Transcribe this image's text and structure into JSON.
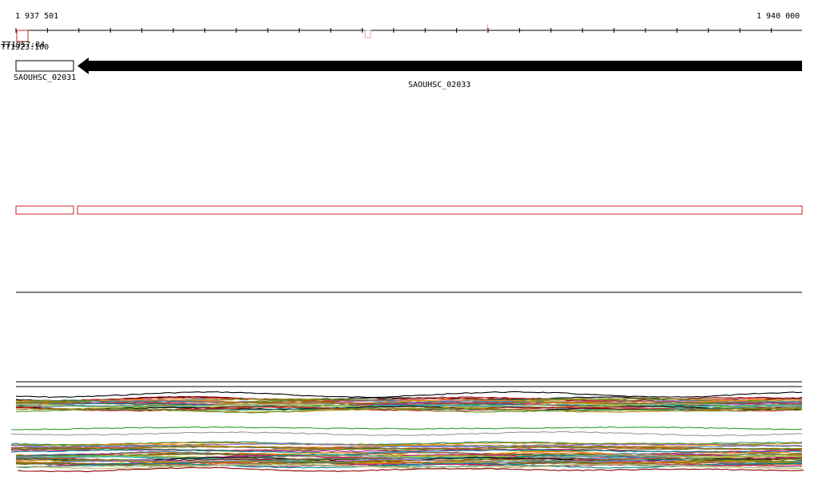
{
  "ruler": {
    "start_label": "1 937 501",
    "end_label": "1 940 000"
  },
  "tss_labels": {
    "label_a": "TT1957:84",
    "label_b": "TT1923:100"
  },
  "genes": [
    {
      "name": "SAOUHSC_02031",
      "strand": "+",
      "style": "outline"
    },
    {
      "name": "SAOUHSC_02033",
      "strand": "-",
      "style": "filled"
    }
  ],
  "colors": {
    "axis": "#000000",
    "feature_box": "#cc2222",
    "gene_fill": "#000000",
    "marker_light": "#e8a0a0",
    "track_palette": [
      "#000000",
      "#8b0000",
      "#cc3333",
      "#2e8b57",
      "#b8860b",
      "#6b8e23",
      "#9370db",
      "#ff8c00",
      "#4682b4",
      "#a0522d",
      "#808000",
      "#d2691e",
      "#556b2f",
      "#c71585",
      "#008b8b",
      "#8fbc8f",
      "#bdb76b",
      "#9acd32",
      "#20b2aa",
      "#708090"
    ]
  }
}
